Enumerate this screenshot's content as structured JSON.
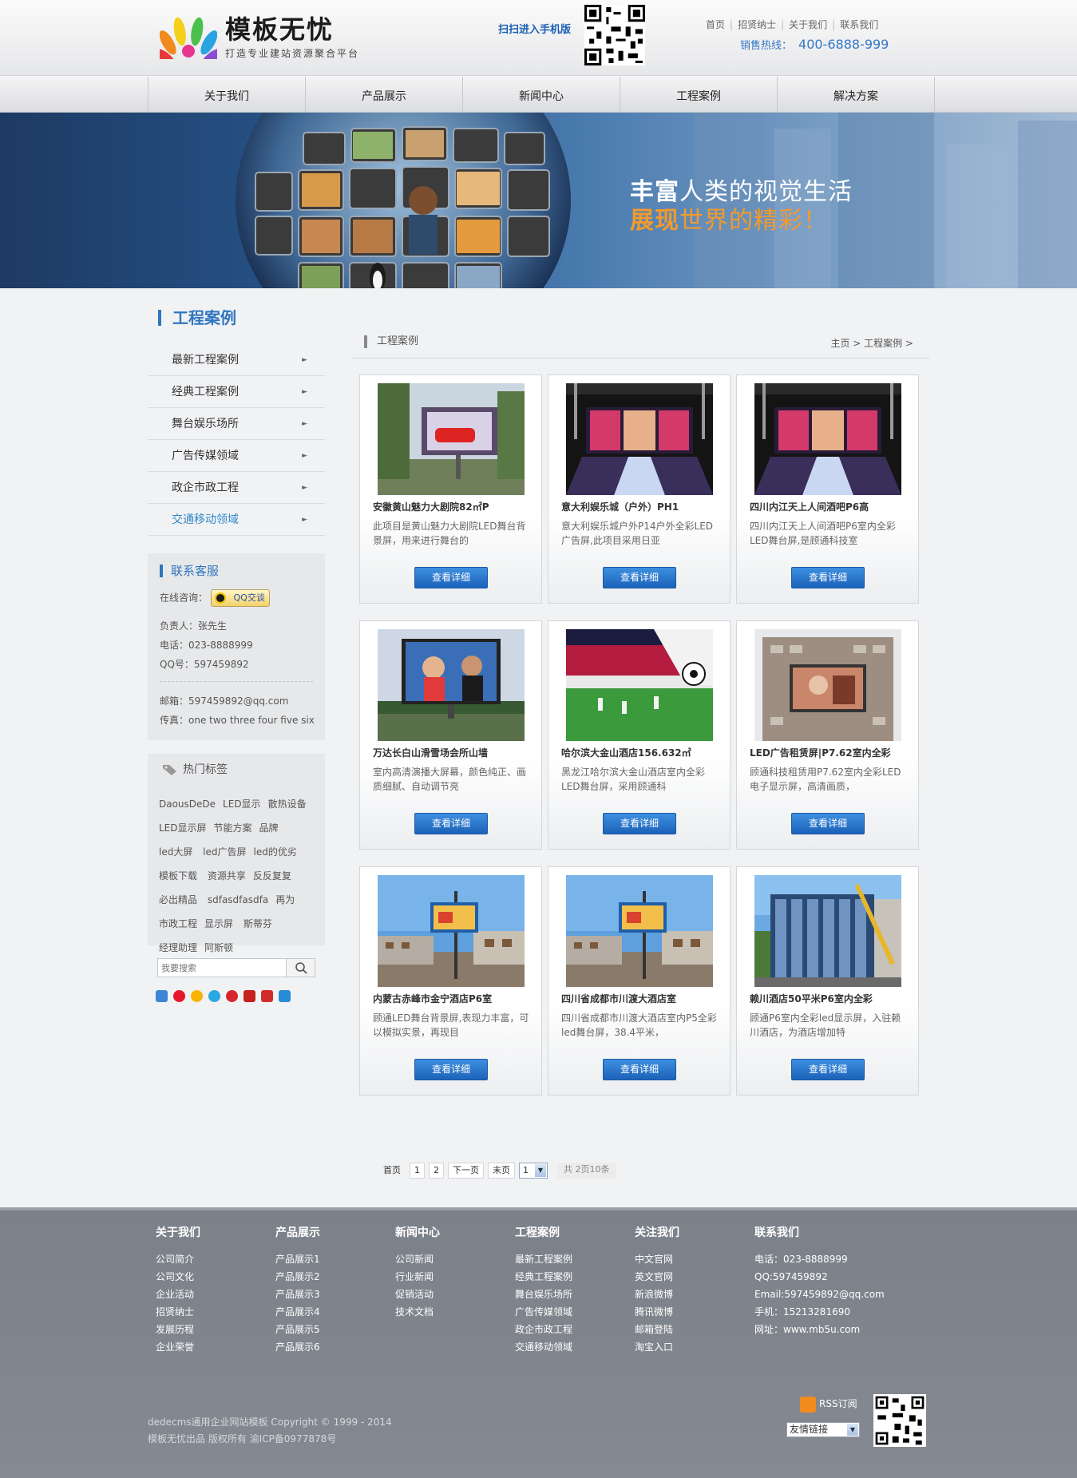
{
  "header": {
    "logo_title": "模板无忧",
    "logo_slogan": "打造专业建站资源聚合平台",
    "scan_text": "扫扫进入手机版",
    "top_links": [
      "首页",
      "招贤纳士",
      "关于我们",
      "联系我们"
    ],
    "hotline_label": "销售热线：",
    "hotline_number": "400-6888-999"
  },
  "nav": [
    "关于我们",
    "产品展示",
    "新闻中心",
    "工程案例",
    "解决方案"
  ],
  "banner": {
    "line1_bold": "丰富",
    "line1_rest": "人类的视觉生活",
    "line2_bold": "展现",
    "line2_rest": "世界的精彩！"
  },
  "sidebar": {
    "title": "工程案例",
    "menu": [
      "最新工程案例",
      "经典工程案例",
      "舞台娱乐场所",
      "广告传媒领域",
      "政企市政工程",
      "交通移动领域"
    ],
    "active_index": 5,
    "contact": {
      "title": "联系客服",
      "online_label": "在线咨询：",
      "qq_button": "QQ交谈",
      "person": "负责人：张先生",
      "phone": "电话：023-8888999",
      "qq": "QQ号：597459892",
      "email": "邮箱：597459892@qq.com",
      "fax": "传真：one two three four five six"
    },
    "tags": {
      "title": "热门标签",
      "items": [
        "DaousDeDe",
        "LED显示",
        "散热设备",
        "LED显示屏",
        "节能方案",
        "品牌",
        "led大屏",
        "led广告屏",
        "led的优劣",
        "模板下载",
        "资源共享",
        "反反复复",
        "必出精品",
        "sdfasdfasdfa",
        "再为",
        "市政工程",
        "显示屏",
        "斯蒂芬",
        "经理助理",
        "阿斯顿"
      ]
    },
    "search_placeholder": "我要搜索",
    "share_icons": [
      "qzone-icon",
      "weibo-icon",
      "favorite-icon",
      "pengyou-icon",
      "renren-icon",
      "tieba-icon",
      "tencent-weibo-icon",
      "home-icon"
    ]
  },
  "main": {
    "title": "工程案例",
    "breadcrumb": "主页 > 工程案例 >",
    "button_label": "查看详细",
    "cases": [
      {
        "title": "安徽黄山魅力大剧院82㎡P",
        "desc": "此项目是黄山魅力大剧院LED舞台背景屏，用来进行舞台的",
        "thumb": "outdoor-billboard"
      },
      {
        "title": "意大利娱乐城（户外）PH1",
        "desc": "意大利娱乐城户外P14户外全彩LED广告屏,此项目采用日亚",
        "thumb": "stage"
      },
      {
        "title": "四川内江天上人间酒吧P6高",
        "desc": "四川内江天上人间酒吧P6室内全彩LED舞台屏,是顾通科技室",
        "thumb": "stage"
      },
      {
        "title": "万达长白山滑雪场会所山墙",
        "desc": "室内高清演播大屏幕，颜色纯正、画质细腻、自动调节亮",
        "thumb": "tv-billboard"
      },
      {
        "title": "哈尔滨大金山酒店156.632㎡",
        "desc": "黑龙江哈尔滨大金山酒店室内全彩LED舞台屏，采用顾通科",
        "thumb": "football"
      },
      {
        "title": "LED广告租赁屏|P7.62室内全彩",
        "desc": "顾通科技租赁用P7.62室内全彩LED电子显示屏，高清画质，",
        "thumb": "building-screen"
      },
      {
        "title": "内蒙古赤峰市金宁酒店P6室",
        "desc": "顾通LED舞台背景屏,表现力丰富，可以模拟实景，再现目",
        "thumb": "street-pole"
      },
      {
        "title": "四川省成都市川渡大酒店室",
        "desc": "四川省成都市川渡大酒店室内P5全彩led舞台屏，38.4平米，",
        "thumb": "street-pole"
      },
      {
        "title": "赖川酒店50平米P6室内全彩",
        "desc": "顾通P6室内全彩led显示屏，入驻赖川酒店，为酒店增加特",
        "thumb": "glass-building"
      }
    ]
  },
  "pager": {
    "first": "首页",
    "pages": [
      "1",
      "2"
    ],
    "next": "下一页",
    "last": "末页",
    "select_value": "1",
    "info": "共 2页10条"
  },
  "footer": {
    "columns": [
      {
        "heading": "关于我们",
        "links": [
          "公司简介",
          "公司文化",
          "企业活动",
          "招贤纳士",
          "发展历程",
          "企业荣誉"
        ]
      },
      {
        "heading": "产品展示",
        "links": [
          "产品展示1",
          "产品展示2",
          "产品展示3",
          "产品展示4",
          "产品展示5",
          "产品展示6"
        ]
      },
      {
        "heading": "新闻中心",
        "links": [
          "公司新闻",
          "行业新闻",
          "促销活动",
          "技术文档"
        ]
      },
      {
        "heading": "工程案例",
        "links": [
          "最新工程案例",
          "经典工程案例",
          "舞台娱乐场所",
          "广告传媒领域",
          "政企市政工程",
          "交通移动领域"
        ]
      },
      {
        "heading": "关注我们",
        "links": [
          "中文官网",
          "英文官网",
          "新浪微博",
          "腾讯微博",
          "邮箱登陆",
          "淘宝入口"
        ]
      },
      {
        "heading": "联系我们",
        "links": [
          "电话：023-8888999",
          "QQ:597459892",
          "Email:597459892@qq.com",
          "手机：15213281690",
          "网址：www.mb5u.com"
        ]
      }
    ],
    "copyright1": "dedecms通用企业网站模板 Copyright © 1999 - 2014",
    "copyright2": "模板无忧出品 版权所有 渝ICP备0977878号",
    "rss_label": "RSS订阅",
    "friend_select": "友情链接"
  },
  "colors": {
    "accent": "#2f76c0",
    "button": "#1c62b9",
    "banner_orange": "#f29a2e",
    "footer_bg": "#7f858d"
  }
}
